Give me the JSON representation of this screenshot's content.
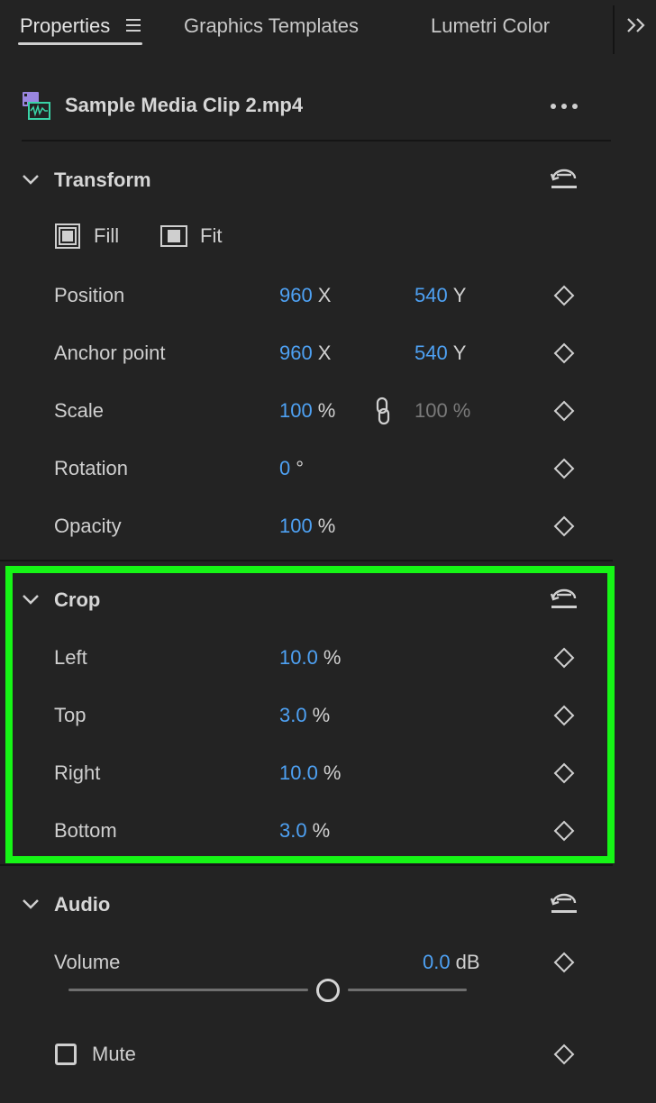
{
  "tabs": [
    {
      "label": "Properties"
    },
    {
      "label": "Graphics Templates"
    },
    {
      "label": "Lumetri Color"
    }
  ],
  "clip": {
    "name": "Sample Media Clip 2.mp4"
  },
  "transform": {
    "title": "Transform",
    "fill_label": "Fill",
    "fit_label": "Fit",
    "rows": [
      {
        "label": "Position",
        "x": "960",
        "x_unit": "X",
        "y": "540",
        "y_unit": "Y"
      },
      {
        "label": "Anchor point",
        "x": "960",
        "x_unit": "X",
        "y": "540",
        "y_unit": "Y"
      },
      {
        "label": "Scale",
        "x": "100",
        "x_unit": "%",
        "y": "100",
        "y_unit": "%"
      },
      {
        "label": "Rotation",
        "x": "0",
        "x_unit": "°"
      },
      {
        "label": "Opacity",
        "x": "100",
        "x_unit": "%"
      }
    ]
  },
  "crop": {
    "title": "Crop",
    "rows": [
      {
        "label": "Left",
        "value": "10.0",
        "unit": "%"
      },
      {
        "label": "Top",
        "value": "3.0",
        "unit": "%"
      },
      {
        "label": "Right",
        "value": "10.0",
        "unit": "%"
      },
      {
        "label": "Bottom",
        "value": "3.0",
        "unit": "%"
      }
    ]
  },
  "audio": {
    "title": "Audio",
    "volume_label": "Volume",
    "volume_value": "0.0",
    "volume_unit": "dB",
    "volume_slider_fraction": 0.65,
    "mute_label": "Mute",
    "mute_checked": false
  },
  "colors": {
    "accent_value": "#4ea1f3",
    "highlight": "#16f516"
  }
}
